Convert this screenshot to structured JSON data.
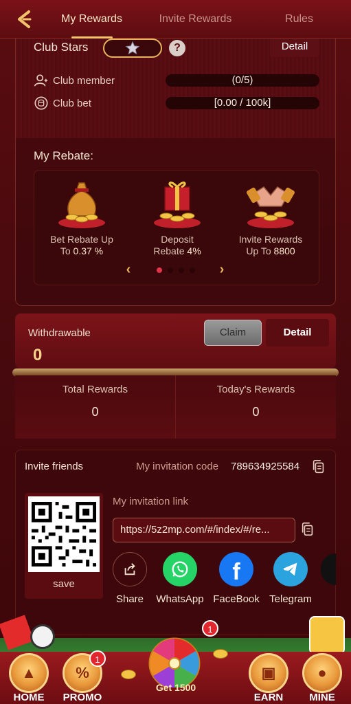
{
  "topbar": {
    "tabs": [
      {
        "label": "My Rewards",
        "active": true
      },
      {
        "label": "Invite Rewards",
        "active": false
      },
      {
        "label": "Rules",
        "active": false
      }
    ]
  },
  "club": {
    "title": "Club Stars",
    "detail_label": "Detail",
    "member_label": "Club member",
    "member_progress": "(0/5)",
    "bet_label": "Club bet",
    "bet_progress": "[0.00 / 100k]"
  },
  "rebate": {
    "title": "My Rebate:",
    "items": [
      {
        "line1": "Bet Rebate Up",
        "line2a": "To ",
        "line2b": "0.37 %"
      },
      {
        "line1": "Deposit",
        "line2a": "Rebate ",
        "line2b": "4%"
      },
      {
        "line1": "Invite Rewards",
        "line2a": "Up To ",
        "line2b": "8800"
      }
    ],
    "active_dot": 0,
    "dot_count": 4
  },
  "withdraw": {
    "label": "Withdrawable",
    "value": "0",
    "claim_label": "Claim",
    "detail_label": "Detail"
  },
  "totals": [
    {
      "label": "Total Rewards",
      "value": "0"
    },
    {
      "label": "Today's Rewards",
      "value": "0"
    }
  ],
  "invite": {
    "title": "Invite friends",
    "code_label": "My invitation code",
    "code": "789634925584",
    "save_label": "save",
    "link_label": "My invitation link",
    "link": "https://5z2mp.com/#/index/#/re...",
    "share": [
      {
        "label": "Share",
        "color": "#3a070a"
      },
      {
        "label": "WhatsApp",
        "color": "#25d366"
      },
      {
        "label": "FaceBook",
        "color": "#1877f2"
      },
      {
        "label": "Telegram",
        "color": "#2aa3df"
      }
    ]
  },
  "bottom_nav": {
    "home": "HOME",
    "promo": "PROMO",
    "promo_badge": "1",
    "get": "Get 1500",
    "wheel_badge": "1",
    "earn": "EARN",
    "mine": "MINE"
  },
  "colors": {
    "accent_gold": "#f2c36a",
    "background": "#4a0a0e",
    "badge_red": "#e3262e"
  }
}
